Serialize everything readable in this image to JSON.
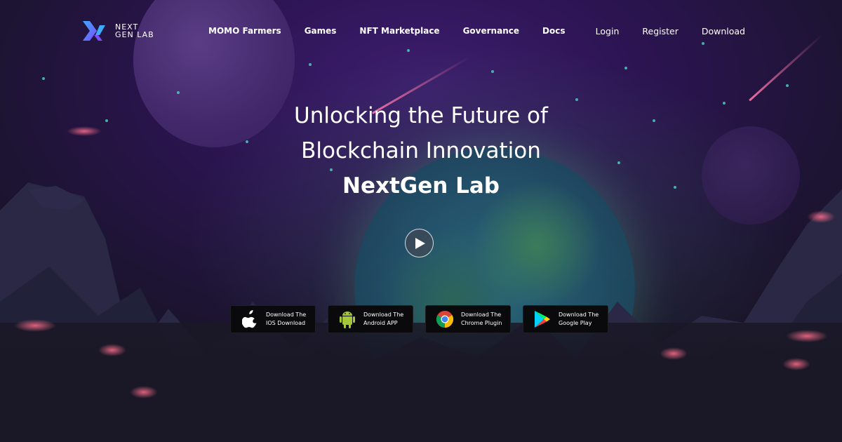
{
  "brand": {
    "logo_line1": "NEXT",
    "logo_line2": "GEN LAB",
    "colors": {
      "logo_accent": "#7b4dff",
      "logo_accent2": "#3da9ff"
    }
  },
  "nav": {
    "items": [
      {
        "label": "MOMO Farmers"
      },
      {
        "label": "Games"
      },
      {
        "label": "NFT Marketplace"
      },
      {
        "label": "Governance"
      },
      {
        "label": "Docs"
      }
    ],
    "auth": [
      {
        "label": "Login"
      },
      {
        "label": "Register"
      },
      {
        "label": "Download"
      }
    ]
  },
  "hero": {
    "line1": "Unlocking the Future of",
    "line2": "Blockchain Innovation",
    "line3": "NextGen Lab",
    "play_icon": "play-icon"
  },
  "downloads": [
    {
      "icon": "apple-icon",
      "line1": "Download The",
      "line2": "IOS Download"
    },
    {
      "icon": "android-icon",
      "line1": "Download The",
      "line2": "Android APP"
    },
    {
      "icon": "chrome-icon",
      "line1": "Download The",
      "line2": "Chrome Plugin"
    },
    {
      "icon": "google-play-icon",
      "line1": "Download The",
      "line2": "Google Play"
    }
  ]
}
